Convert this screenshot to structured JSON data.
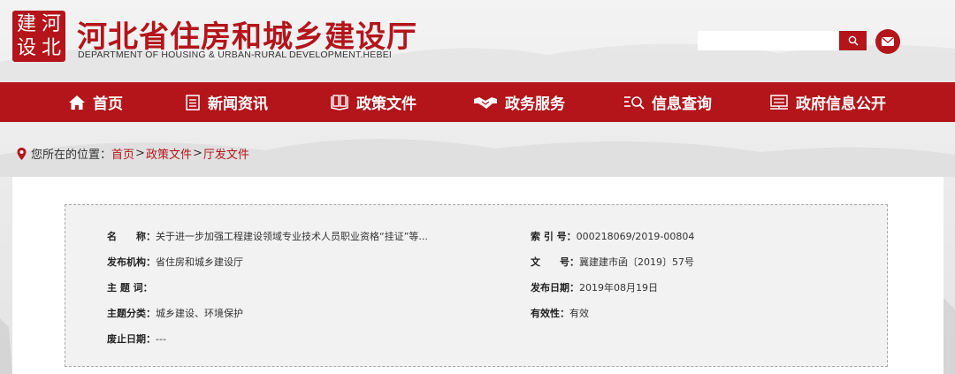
{
  "header": {
    "seal_chars": [
      "建",
      "河",
      "设",
      "北"
    ],
    "title_cn": "河北省住房和城乡建设厅",
    "title_en": "DEPARTMENT OF HOUSING & URBAN-RURAL DEVELOPMENT.HEBEI",
    "search": {
      "value": "",
      "placeholder": ""
    },
    "search_icon": "search-icon",
    "mail_icon": "mail-icon"
  },
  "nav": {
    "items": [
      {
        "label": "首页",
        "icon": "home-icon"
      },
      {
        "label": "新闻资讯",
        "icon": "news-icon"
      },
      {
        "label": "政策文件",
        "icon": "book-icon"
      },
      {
        "label": "政务服务",
        "icon": "handshake-icon"
      },
      {
        "label": "信息查询",
        "icon": "search-list-icon"
      },
      {
        "label": "政府信息公开",
        "icon": "board-icon"
      }
    ]
  },
  "breadcrumb": {
    "prefix": "您所在的位置：",
    "items": [
      "首页",
      "政策文件",
      "厅发文件"
    ],
    "separator": ">"
  },
  "info": {
    "name_label": "名　　称：",
    "name_value": "关于进一步加强工程建设领域专业技术人员职业资格“挂证”等...",
    "index_label": "索 引 号：",
    "index_value": "000218069/2019-00804",
    "org_label": "发布机构：",
    "org_value": "省住房和城乡建设厅",
    "docno_label": "文　　号：",
    "docno_value": "冀建建市函〔2019〕57号",
    "keyword_label": "主 题 词：",
    "keyword_value": "",
    "date_label": "发布日期：",
    "date_value": "2019年08月19日",
    "category_label": "主题分类：",
    "category_value": "城乡建设、环境保护",
    "validity_label": "有效性：",
    "validity_value": "有效",
    "expire_label": "废止日期：",
    "expire_value": "---"
  },
  "colors": {
    "brand_red": "#b3151b",
    "panel_bg": "#f2f2f2"
  }
}
